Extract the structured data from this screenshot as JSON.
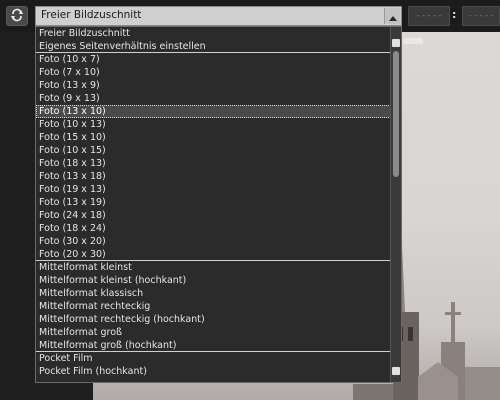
{
  "toolbar": {
    "format_select_value": "Freier Bildzuschnitt",
    "ratio_width_value": "-----",
    "ratio_separator": ":",
    "ratio_height_value": "-----"
  },
  "format_menu": {
    "items": [
      {
        "label": "Freier Bildzuschnitt"
      },
      {
        "label": "Eigenes Seitenverhältnis einstellen",
        "separator_after": true
      },
      {
        "label": "Foto (10 x 7)"
      },
      {
        "label": "Foto (7 x 10)"
      },
      {
        "label": "Foto (13 x 9)"
      },
      {
        "label": "Foto (9 x 13)"
      },
      {
        "label": "Foto (13 x 10)",
        "selected": true
      },
      {
        "label": "Foto (10 x 13)"
      },
      {
        "label": "Foto (15 x 10)"
      },
      {
        "label": "Foto (10 x 15)"
      },
      {
        "label": "Foto (18 x 13)"
      },
      {
        "label": "Foto (13 x 18)"
      },
      {
        "label": "Foto (19 x 13)"
      },
      {
        "label": "Foto (13 x 19)"
      },
      {
        "label": "Foto (24 x 18)"
      },
      {
        "label": "Foto (18 x 24)"
      },
      {
        "label": "Foto (30 x 20)"
      },
      {
        "label": "Foto (20 x 30)",
        "separator_after": true
      },
      {
        "label": "Mittelformat kleinst"
      },
      {
        "label": "Mittelformat kleinst (hochkant)"
      },
      {
        "label": "Mittelformat klassisch"
      },
      {
        "label": "Mittelformat rechteckig"
      },
      {
        "label": "Mittelformat rechteckig (hochkant)"
      },
      {
        "label": "Mittelformat groß"
      },
      {
        "label": "Mittelformat groß (hochkant)",
        "separator_after": true
      },
      {
        "label": "Pocket Film"
      },
      {
        "label": "Pocket Film (hochkant)"
      }
    ],
    "scroll_position": 0.0,
    "visible_fraction": 0.4
  },
  "colors": {
    "menu_background": "#2b2b2b",
    "menu_text": "#e6e6e6",
    "select_background": "#cfcfcf"
  }
}
